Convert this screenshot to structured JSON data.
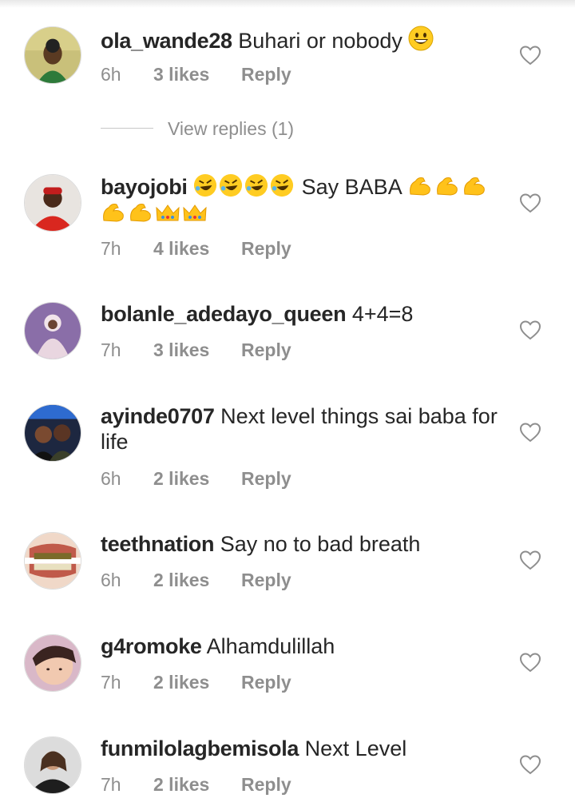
{
  "comments": [
    {
      "username": "ola_wande28",
      "text": "Buhari or nobody",
      "emoji": [
        "grin-emoji"
      ],
      "time": "6h",
      "likes": "3 likes",
      "reply": "Reply"
    },
    {
      "username": "bayojobi",
      "text": "Say BABA",
      "emoji_before": [
        "rofl-emoji",
        "rofl-emoji",
        "rofl-emoji",
        "rofl-emoji"
      ],
      "emoji_after": [
        "muscle-emoji",
        "muscle-emoji",
        "muscle-emoji",
        "muscle-emoji",
        "muscle-emoji",
        "crown-emoji",
        "crown-emoji"
      ],
      "time": "7h",
      "likes": "4 likes",
      "reply": "Reply"
    },
    {
      "username": "bolanle_adedayo_queen",
      "text": "4+4=8",
      "time": "7h",
      "likes": "3 likes",
      "reply": "Reply"
    },
    {
      "username": "ayinde0707",
      "text": "Next level things sai baba for life",
      "time": "6h",
      "likes": "2 likes",
      "reply": "Reply"
    },
    {
      "username": "teethnation",
      "text": "Say no to bad breath",
      "time": "6h",
      "likes": "2 likes",
      "reply": "Reply"
    },
    {
      "username": "g4romoke",
      "text": "Alhamdulillah",
      "time": "7h",
      "likes": "2 likes",
      "reply": "Reply"
    },
    {
      "username": "funmilolagbemisola",
      "text": "Next Level",
      "time": "7h",
      "likes": "2 likes",
      "reply": "Reply"
    }
  ],
  "view_replies": "View replies (1)",
  "icons": {
    "like": "heart-outline-icon"
  },
  "colors": {
    "text": "#262626",
    "muted": "#8e8e8e",
    "divider": "#c7c7c7"
  }
}
